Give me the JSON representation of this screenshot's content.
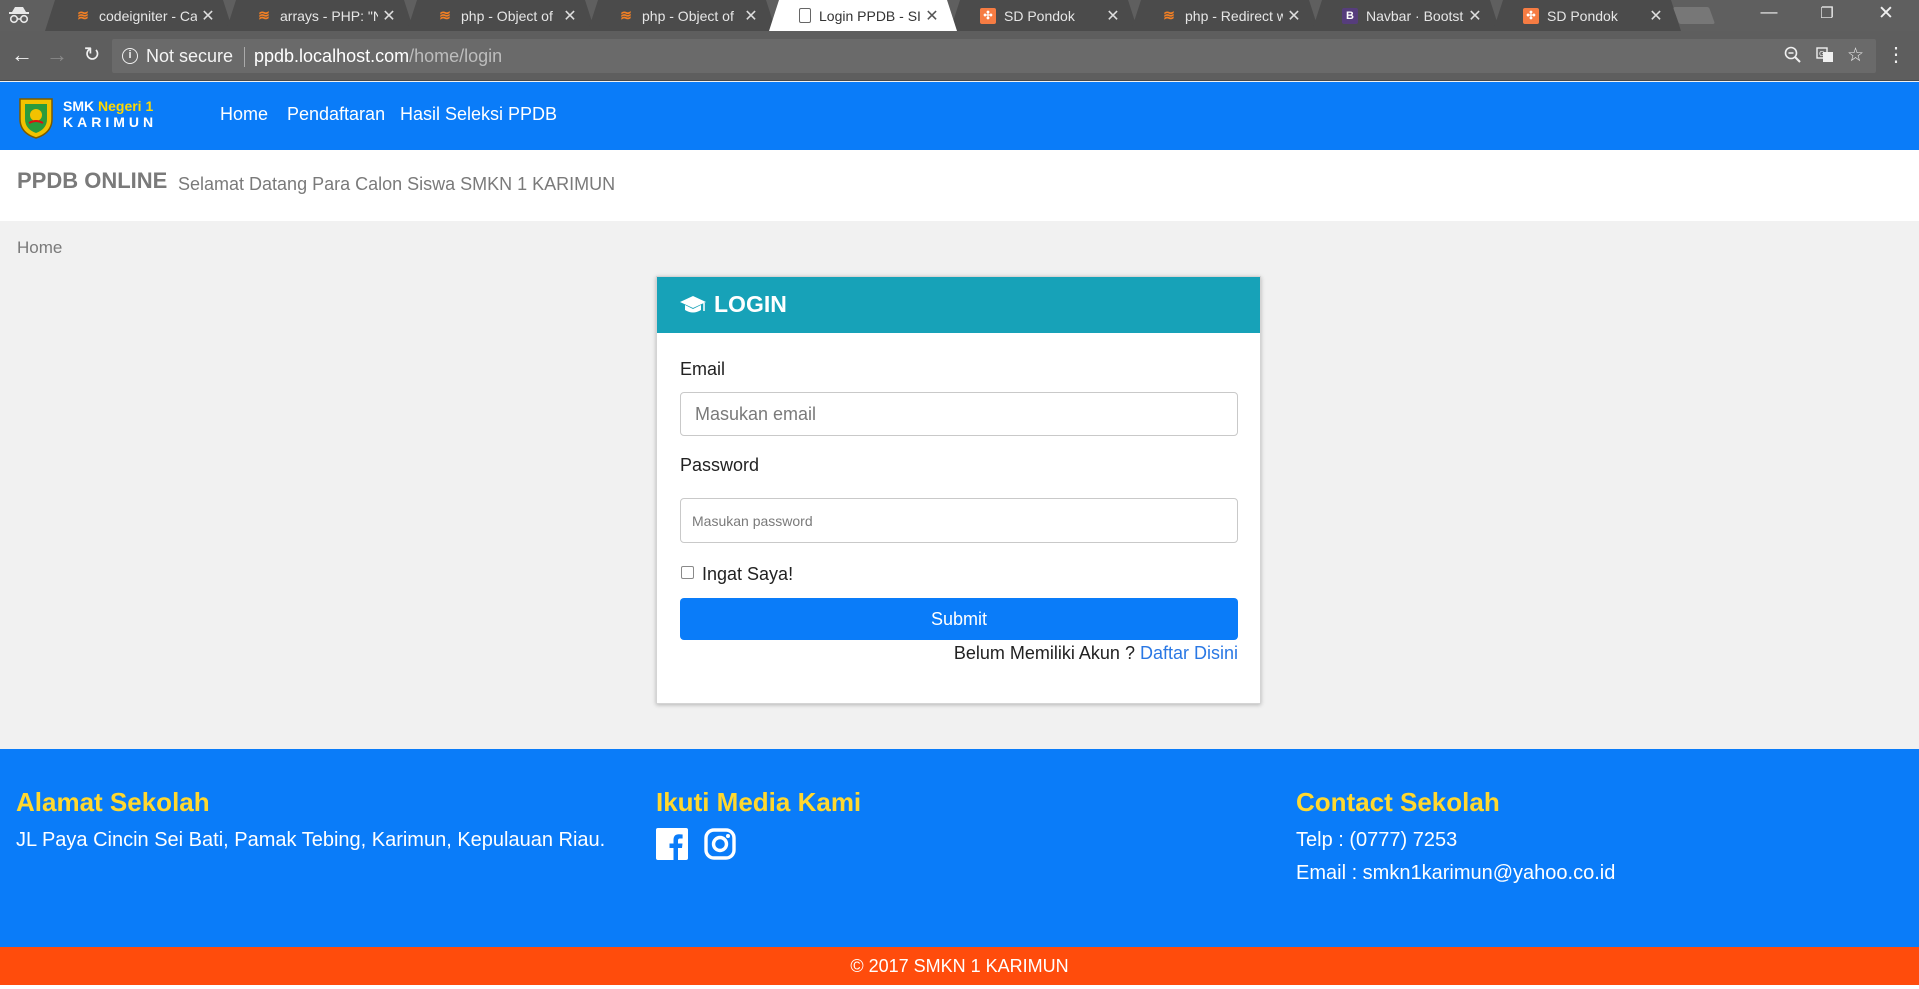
{
  "browser": {
    "tabs": [
      {
        "title": "codeigniter - Ca",
        "favicon": "stackoverflow-icon"
      },
      {
        "title": "arrays - PHP: \"N",
        "favicon": "stackoverflow-icon"
      },
      {
        "title": "php - Object of",
        "favicon": "stackoverflow-icon"
      },
      {
        "title": "php - Object of",
        "favicon": "stackoverflow-icon"
      },
      {
        "title": "Login PPDB - SI",
        "favicon": "document-icon",
        "active": true
      },
      {
        "title": "SD Pondok",
        "favicon": "xampp-icon"
      },
      {
        "title": "php - Redirect w",
        "favicon": "stackoverflow-icon"
      },
      {
        "title": "Navbar · Bootstr",
        "favicon": "bootstrap-icon",
        "favicon_text": "B"
      },
      {
        "title": "SD Pondok",
        "favicon": "xampp-icon"
      }
    ],
    "security_label": "Not secure",
    "url_host": "ppdb.localhost.com",
    "url_path": "/home/login"
  },
  "navbar": {
    "brand_line1_a": "SMK ",
    "brand_line1_b": "Negeri 1",
    "brand_line2": "KARIMUN",
    "links": [
      "Home",
      "Pendaftaran",
      "Hasil Seleksi PPDB"
    ]
  },
  "jumbotron": {
    "title": "PPDB ONLINE",
    "subtitle": "Selamat Datang Para Calon Siswa SMKN 1 KARIMUN"
  },
  "breadcrumb": "Home",
  "login": {
    "header": "LOGIN",
    "email_label": "Email",
    "email_placeholder": "Masukan email",
    "password_label": "Password",
    "password_placeholder": "Masukan password",
    "remember_label": "Ingat Saya!",
    "remember_checked": false,
    "submit_label": "Submit",
    "register_prompt": "Belum Memiliki Akun ? ",
    "register_link": "Daftar Disini"
  },
  "footer": {
    "address_title": "Alamat Sekolah",
    "address": "JL Paya Cincin Sei Bati, Pamak Tebing, Karimun, Kepulauan Riau.",
    "media_title": "Ikuti Media Kami",
    "social": [
      "facebook-icon",
      "instagram-icon"
    ],
    "contact_title": "Contact Sekolah",
    "phone": "Telp : (0777) 7253",
    "email": "Email : smkn1karimun@yahoo.co.id",
    "copyright": "© 2017 SMKN 1 KARIMUN"
  },
  "colors": {
    "primary": "#0a7cf9",
    "card_header": "#17a2b8",
    "footer_heading": "#ffd82f",
    "copyright_bar": "#ff4c0c",
    "link": "#2a78e4"
  }
}
